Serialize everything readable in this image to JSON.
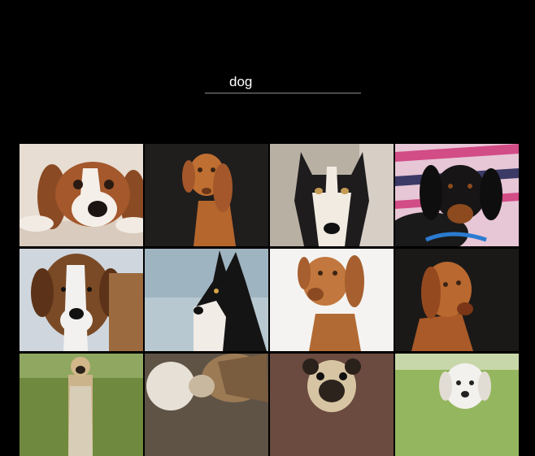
{
  "search": {
    "query": "dog"
  },
  "results": [
    {
      "name": "cavalier-spaniel-lying-photo"
    },
    {
      "name": "vizsla-dark-background-photo"
    },
    {
      "name": "husky-portrait-photo"
    },
    {
      "name": "dachshund-pink-blanket-photo"
    },
    {
      "name": "saint-bernard-snow-photo"
    },
    {
      "name": "husky-profile-photo"
    },
    {
      "name": "vizsla-head-tilt-photo"
    },
    {
      "name": "vizsla-dark-portrait-photo"
    },
    {
      "name": "pug-in-grass-photo"
    },
    {
      "name": "dog-and-cat-photo"
    },
    {
      "name": "pug-face-photo"
    },
    {
      "name": "white-puppy-grass-photo"
    }
  ]
}
